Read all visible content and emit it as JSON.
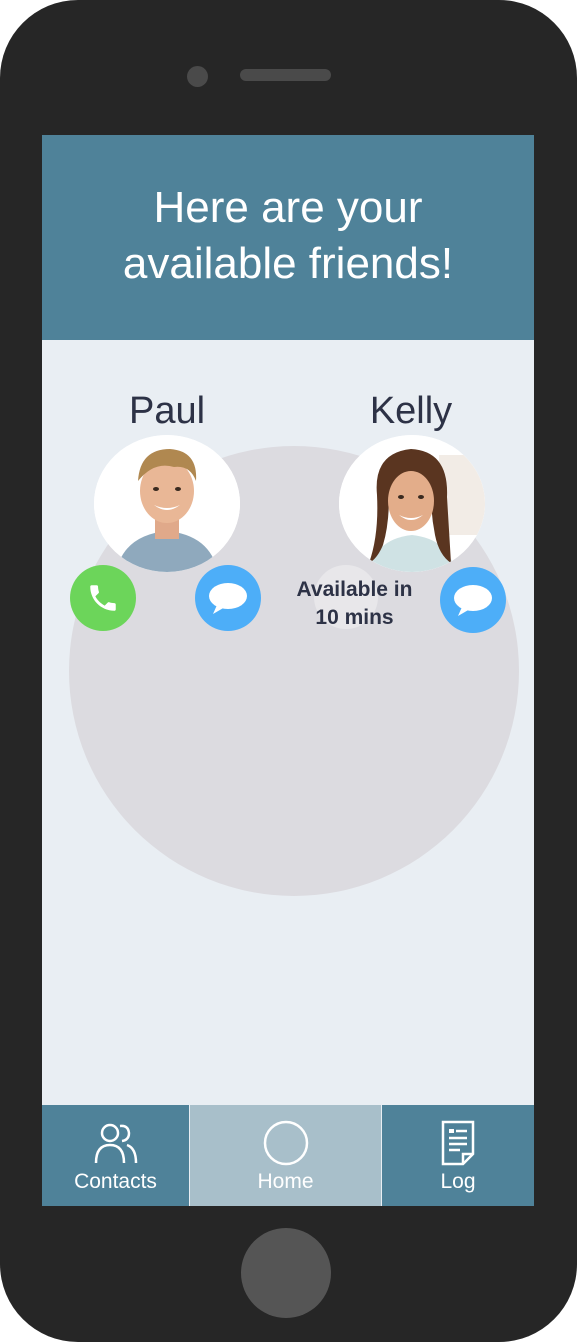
{
  "header": {
    "title": "Here are your available friends!"
  },
  "contacts": [
    {
      "name": "Paul",
      "actions": [
        "phone-call",
        "message"
      ]
    },
    {
      "name": "Kelly",
      "status": "Available in 10 mins",
      "actions": [
        "message"
      ]
    }
  ],
  "tabbar": {
    "items": [
      {
        "label": "Contacts",
        "icon": "contacts-icon"
      },
      {
        "label": "Home",
        "icon": "home-circle-icon",
        "selected": true
      },
      {
        "label": "Log",
        "icon": "log-document-icon"
      }
    ]
  },
  "colors": {
    "header": "#4f8299",
    "screen_bg": "#e9eef3",
    "call_green": "#6cd55a",
    "message_blue": "#4daef8",
    "selected_tab": "#a8bfca"
  }
}
